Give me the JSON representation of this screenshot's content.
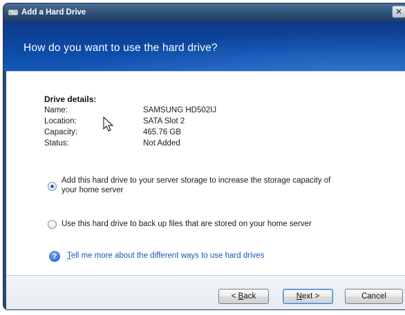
{
  "window": {
    "title": "Add a Hard Drive",
    "close_glyph": "✕"
  },
  "header": {
    "title": "How do you want to use the hard drive?"
  },
  "drive_details": {
    "heading": "Drive details:",
    "rows": [
      {
        "label": "Name:",
        "value": "SAMSUNG HD502IJ"
      },
      {
        "label": "Location:",
        "value": "SATA Slot 2"
      },
      {
        "label": "Capacity:",
        "value": "465.76 GB"
      },
      {
        "label": "Status:",
        "value": "Not Added"
      }
    ]
  },
  "options": [
    {
      "line1": "Add this hard drive to your server storage to increase the storage capacity of",
      "line2": "your home server",
      "selected": true
    },
    {
      "line1": "Use this hard drive to back up files that are stored on your home server",
      "selected": false
    }
  ],
  "help": {
    "icon_glyph": "?",
    "link_accel": "T",
    "link_rest": "ell me more about the different ways to use hard drives"
  },
  "buttons": {
    "back_prefix": "< ",
    "back_accel": "B",
    "back_rest": "ack",
    "next_accel": "N",
    "next_rest": "ext >",
    "cancel": "Cancel"
  },
  "colors": {
    "header_blue": "#0b4aa6",
    "link_blue": "#1b55b8",
    "titlebar": "#2f4f77"
  },
  "icons": {
    "title": "hard-drive-icon",
    "help": "help-question-icon",
    "cursor": "mouse-pointer-icon"
  }
}
